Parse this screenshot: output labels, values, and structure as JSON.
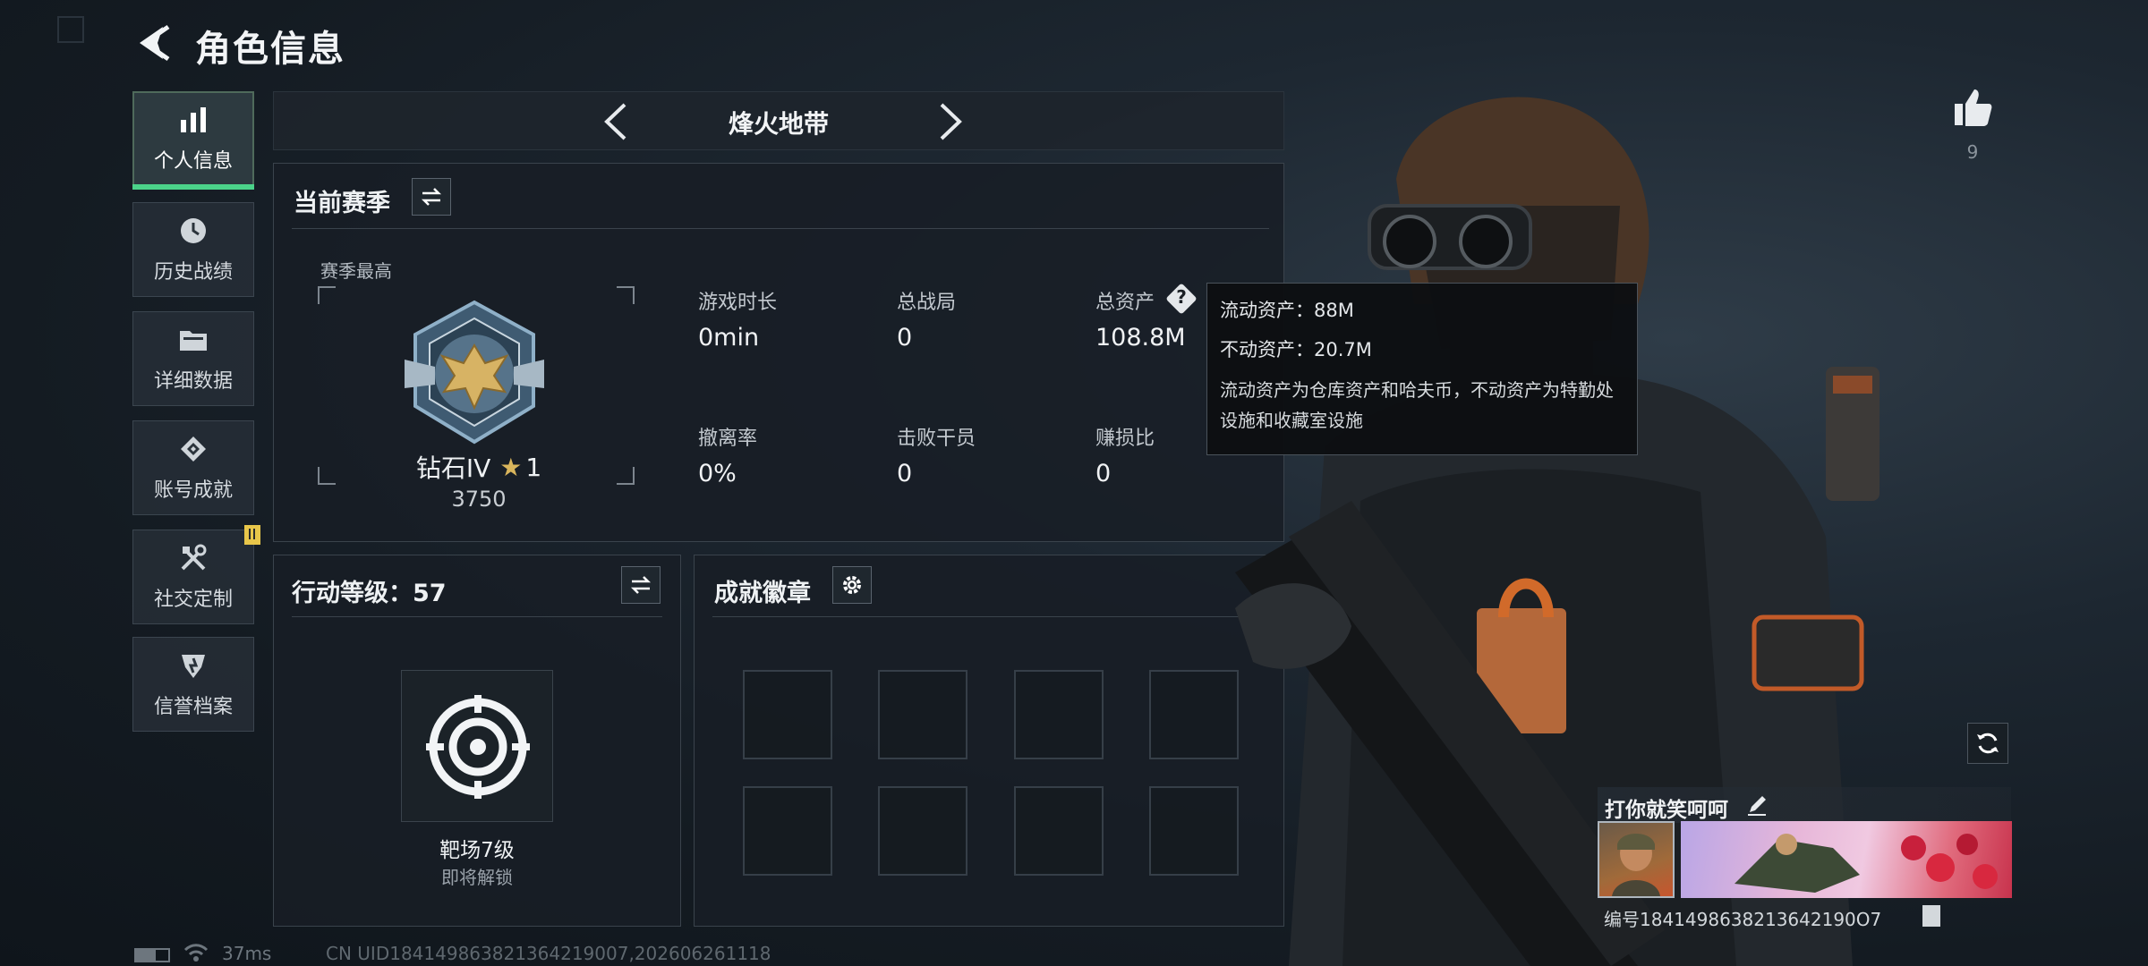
{
  "header": {
    "title": "角色信息"
  },
  "sidebar": {
    "items": [
      {
        "label": "个人信息",
        "icon": "bar-chart-icon",
        "active": true
      },
      {
        "label": "历史战绩",
        "icon": "history-icon"
      },
      {
        "label": "详细数据",
        "icon": "folder-icon"
      },
      {
        "label": "账号成就",
        "icon": "achievement-icon"
      },
      {
        "label": "社交定制",
        "icon": "tools-icon",
        "badge": true
      },
      {
        "label": "信誉档案",
        "icon": "reputation-icon"
      }
    ]
  },
  "mode": {
    "title": "烽火地带"
  },
  "season": {
    "title": "当前赛季",
    "best_label": "赛季最高",
    "rank_name": "钻石IV",
    "rank_stars": "1",
    "rank_points": "3750",
    "stats": [
      {
        "label": "游戏时长",
        "value": "0min"
      },
      {
        "label": "总战局",
        "value": "0"
      },
      {
        "label": "总资产",
        "value": "108.8M"
      },
      {
        "label": "撤离率",
        "value": "0%"
      },
      {
        "label": "击败干员",
        "value": "0"
      },
      {
        "label": "赚损比",
        "value": "0"
      }
    ]
  },
  "tooltip": {
    "liquid": "流动资产：88M",
    "fixed": "不动资产：20.7M",
    "desc": "流动资产为仓库资产和哈夫币，不动资产为特勤处设施和收藏室设施"
  },
  "action_level": {
    "title": "行动等级：57",
    "item_name": "靶场7级",
    "item_status": "即将解锁"
  },
  "achievements": {
    "title": "成就徽章"
  },
  "likes": {
    "count": "9"
  },
  "player": {
    "name": "打你就笑呵呵",
    "id_text": "编号1841498638213642190O7"
  },
  "footer": {
    "ping": "37ms",
    "uid_text": "CN UID18414986382136421900​7,202606261118"
  },
  "colors": {
    "accent_green": "#4bd38a",
    "badge_yellow": "#e8c64a",
    "background": "#1d2731"
  }
}
